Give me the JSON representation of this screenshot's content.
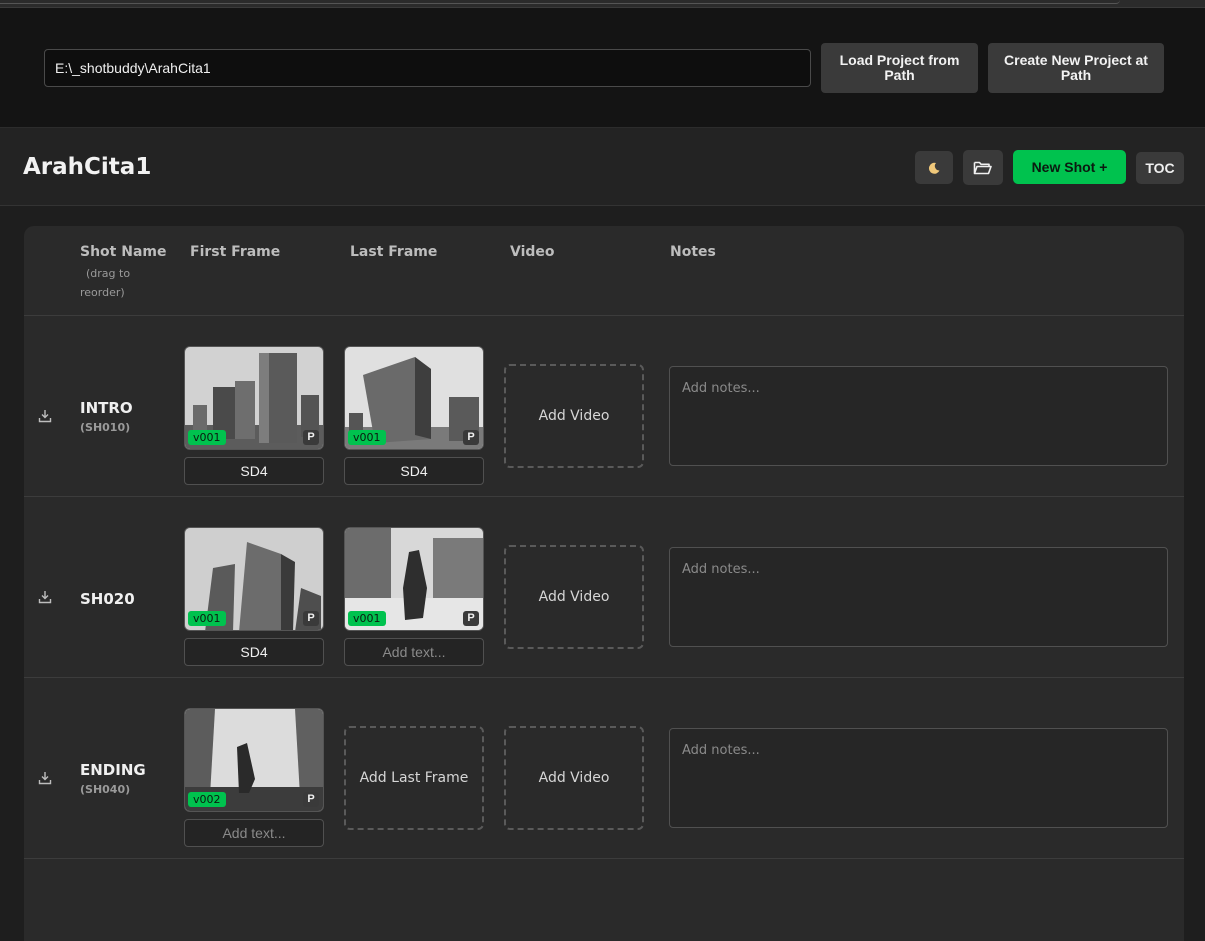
{
  "topbar": {
    "path_value": "E:\\_shotbuddy\\ArahCita1",
    "load_button": "Load Project from Path",
    "create_button": "Create New Project at Path"
  },
  "header": {
    "project_title": "ArahCita1",
    "theme_icon": "moon-icon",
    "folder_icon": "folder-open-icon",
    "new_shot_button": "New Shot +",
    "toc_button": "TOC"
  },
  "columns": {
    "shot_name": "Shot Name",
    "shot_name_hint_1": "(drag to",
    "shot_name_hint_2": "reorder)",
    "first_frame": "First Frame",
    "last_frame": "Last Frame",
    "video": "Video",
    "notes": "Notes"
  },
  "placeholders": {
    "notes": "Add notes...",
    "text": "Add text...",
    "add_video": "Add Video",
    "add_last_frame": "Add Last Frame"
  },
  "shots": [
    {
      "name": "INTRO",
      "code": "(SH010)",
      "first_frame": {
        "version": "v001",
        "flag": "P",
        "label": "SD4"
      },
      "last_frame": {
        "version": "v001",
        "flag": "P",
        "label": "SD4"
      }
    },
    {
      "name": "SH020",
      "code": "",
      "first_frame": {
        "version": "v001",
        "flag": "P",
        "label": "SD4"
      },
      "last_frame": {
        "version": "v001",
        "flag": "P",
        "label": ""
      }
    },
    {
      "name": "ENDING",
      "code": "(SH040)",
      "first_frame": {
        "version": "v002",
        "flag": "P",
        "label": ""
      },
      "last_frame": null
    }
  ],
  "colors": {
    "accent": "#00c24e",
    "background": "#1e1e1e",
    "panel": "#2a2a2a"
  }
}
